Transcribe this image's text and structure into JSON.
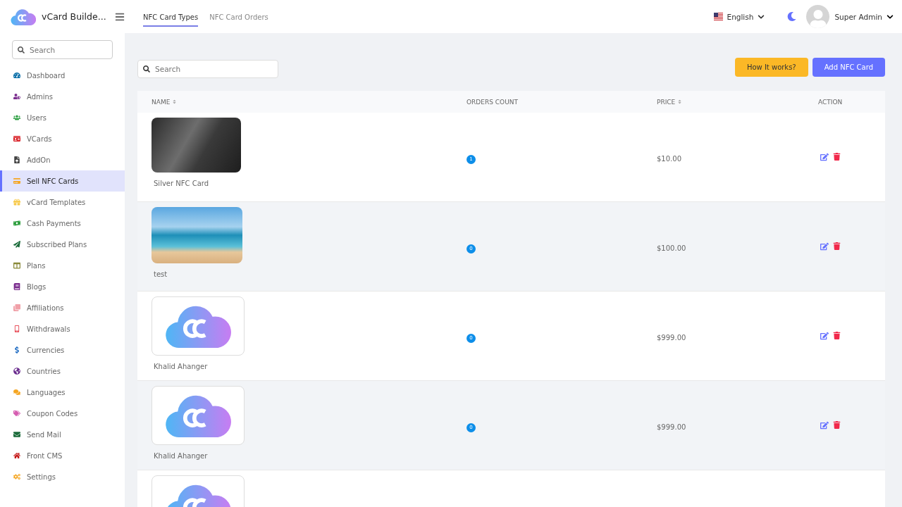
{
  "brand": {
    "name": "vCard Builde..."
  },
  "tabs": [
    {
      "label": "NFC Card Types",
      "selected": true
    },
    {
      "label": "NFC Card Orders",
      "selected": false
    }
  ],
  "language": {
    "label": "English"
  },
  "user": {
    "name": "Super Admin"
  },
  "sidebar": {
    "search": {
      "placeholder": "Search"
    },
    "items": [
      {
        "label": "Dashboard",
        "selected": false
      },
      {
        "label": "Admins",
        "selected": false
      },
      {
        "label": "Users",
        "selected": false
      },
      {
        "label": "VCards",
        "selected": false
      },
      {
        "label": "AddOn",
        "selected": false
      },
      {
        "label": "Sell NFC Cards",
        "selected": true
      },
      {
        "label": "vCard Templates",
        "selected": false
      },
      {
        "label": "Cash Payments",
        "selected": false
      },
      {
        "label": "Subscribed Plans",
        "selected": false
      },
      {
        "label": "Plans",
        "selected": false
      },
      {
        "label": "Blogs",
        "selected": false
      },
      {
        "label": "Affiliations",
        "selected": false
      },
      {
        "label": "Withdrawals",
        "selected": false
      },
      {
        "label": "Currencies",
        "selected": false
      },
      {
        "label": "Countries",
        "selected": false
      },
      {
        "label": "Languages",
        "selected": false
      },
      {
        "label": "Coupon Codes",
        "selected": false
      },
      {
        "label": "Send Mail",
        "selected": false
      },
      {
        "label": "Front CMS",
        "selected": false
      },
      {
        "label": "Settings",
        "selected": false
      }
    ]
  },
  "search": {
    "placeholder": "Search"
  },
  "buttons": [
    {
      "label": "How It works?",
      "kind": "warning"
    },
    {
      "label": "Add NFC Card",
      "kind": "primary"
    }
  ],
  "table": {
    "columns": [
      "NAME",
      "ORDERS COUNT",
      "PRICE",
      "ACTION"
    ],
    "rows": [
      {
        "kind": "card",
        "name": "Silver NFC Card",
        "orders": "1",
        "price": "$10.00"
      },
      {
        "kind": "photo",
        "name": "test",
        "orders": "0",
        "price": "$100.00"
      },
      {
        "kind": "logo",
        "name": "Khalid Ahanger",
        "orders": "0",
        "price": "$999.00"
      },
      {
        "kind": "logo",
        "name": "Khalid Ahanger",
        "orders": "0",
        "price": "$999.00"
      },
      {
        "kind": "logo"
      }
    ]
  }
}
